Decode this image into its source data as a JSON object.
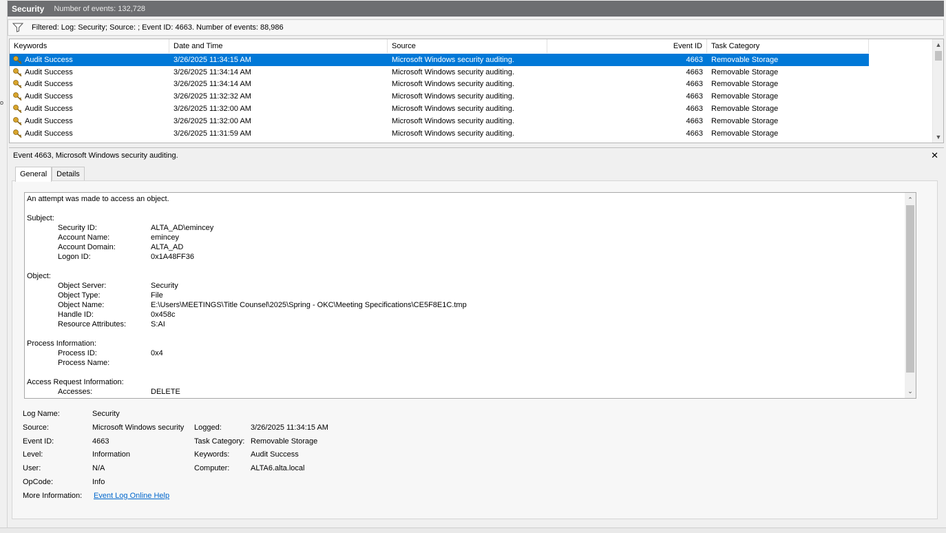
{
  "title_bar": {
    "log_name": "Security",
    "count_text": "Number of events: 132,728"
  },
  "filter_bar": {
    "icon": "funnel-icon",
    "text": "Filtered: Log: Security; Source: ; Event ID: 4663. Number of events: 88,986"
  },
  "grid": {
    "columns": [
      "Keywords",
      "Date and Time",
      "Source",
      "Event ID",
      "Task Category"
    ],
    "rows": [
      {
        "keywords": "Audit Success",
        "date": "3/26/2025 11:34:15 AM",
        "source": "Microsoft Windows security auditing.",
        "event_id": "4663",
        "category": "Removable Storage",
        "selected": true
      },
      {
        "keywords": "Audit Success",
        "date": "3/26/2025 11:34:14 AM",
        "source": "Microsoft Windows security auditing.",
        "event_id": "4663",
        "category": "Removable Storage"
      },
      {
        "keywords": "Audit Success",
        "date": "3/26/2025 11:34:14 AM",
        "source": "Microsoft Windows security auditing.",
        "event_id": "4663",
        "category": "Removable Storage"
      },
      {
        "keywords": "Audit Success",
        "date": "3/26/2025 11:32:32 AM",
        "source": "Microsoft Windows security auditing.",
        "event_id": "4663",
        "category": "Removable Storage"
      },
      {
        "keywords": "Audit Success",
        "date": "3/26/2025 11:32:00 AM",
        "source": "Microsoft Windows security auditing.",
        "event_id": "4663",
        "category": "Removable Storage"
      },
      {
        "keywords": "Audit Success",
        "date": "3/26/2025 11:32:00 AM",
        "source": "Microsoft Windows security auditing.",
        "event_id": "4663",
        "category": "Removable Storage"
      },
      {
        "keywords": "Audit Success",
        "date": "3/26/2025 11:31:59 AM",
        "source": "Microsoft Windows security auditing.",
        "event_id": "4663",
        "category": "Removable Storage"
      }
    ]
  },
  "detail": {
    "header": "Event 4663, Microsoft Windows security auditing.",
    "close_icon": "close-icon",
    "tabs": [
      "General",
      "Details"
    ],
    "description": {
      "intro": "An attempt was made to access an object.",
      "subject_title": "Subject:",
      "subject": [
        {
          "label": "Security ID:",
          "value": "ALTA_AD\\emincey"
        },
        {
          "label": "Account Name:",
          "value": "emincey"
        },
        {
          "label": "Account Domain:",
          "value": "ALTA_AD"
        },
        {
          "label": "Logon ID:",
          "value": "0x1A48FF36"
        }
      ],
      "object_title": "Object:",
      "object": [
        {
          "label": "Object Server:",
          "value": "Security"
        },
        {
          "label": "Object Type:",
          "value": "File"
        },
        {
          "label": "Object Name:",
          "value": "E:\\Users\\MEETINGS\\Title Counsel\\2025\\Spring - OKC\\Meeting Specifications\\CE5F8E1C.tmp"
        },
        {
          "label": "Handle ID:",
          "value": "0x458c"
        },
        {
          "label": "Resource Attributes:",
          "value": "S:AI"
        }
      ],
      "process_title": "Process Information:",
      "process": [
        {
          "label": "Process ID:",
          "value": "0x4"
        },
        {
          "label": "Process Name:",
          "value": ""
        }
      ],
      "access_title": "Access Request Information:",
      "access": [
        {
          "label": "Accesses:",
          "value": "DELETE"
        }
      ]
    },
    "props": {
      "log_name_label": "Log Name:",
      "log_name": "Security",
      "source_label": "Source:",
      "source": "Microsoft Windows security",
      "logged_label": "Logged:",
      "logged": "3/26/2025 11:34:15 AM",
      "event_id_label": "Event ID:",
      "event_id": "4663",
      "task_category_label": "Task Category:",
      "task_category": "Removable Storage",
      "level_label": "Level:",
      "level": "Information",
      "keywords_label": "Keywords:",
      "keywords": "Audit Success",
      "user_label": "User:",
      "user": "N/A",
      "computer_label": "Computer:",
      "computer": "ALTA6.alta.local",
      "opcode_label": "OpCode:",
      "opcode": "Info",
      "more_info_label": "More Information:",
      "more_info_link": "Event Log Online Help"
    }
  },
  "colors": {
    "selection": "#0078d7",
    "title_bar": "#6d6e71",
    "link": "#0066cc"
  }
}
